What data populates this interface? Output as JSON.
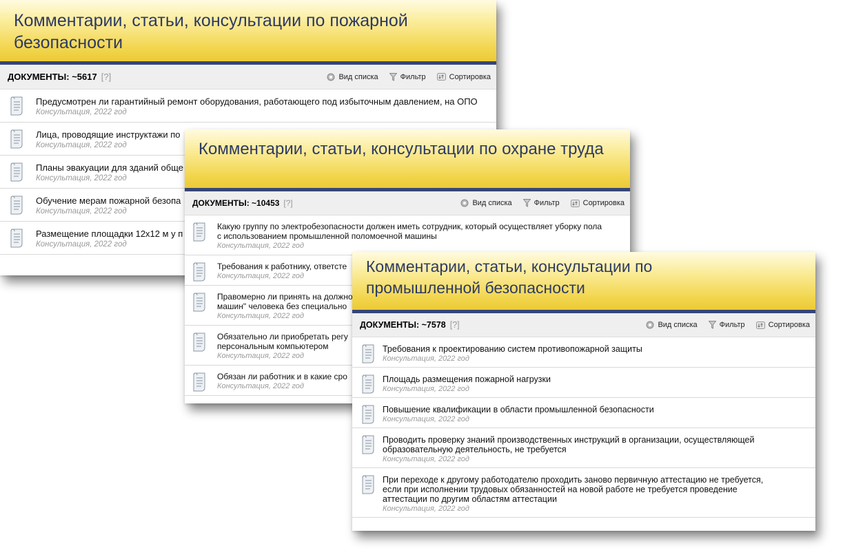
{
  "colors": {
    "header_gradient_top": "#fffbe0",
    "header_gradient_bottom": "#ecca38",
    "header_text": "#2e3a63",
    "header_rule": "#354677",
    "meta_text": "#9a9a9a"
  },
  "toolbar_labels": {
    "view": "Вид списка",
    "filter": "Фильтр",
    "sort": "Сортировка",
    "help": "[?]"
  },
  "panels": [
    {
      "title": "Комментарии, статьи, консультации по пожарной безопасности",
      "docs_label": "ДОКУМЕНТЫ: ~5617",
      "items": [
        {
          "title": "Предусмотрен ли гарантийный ремонт оборудования, работающего под избыточным давлением, на ОПО",
          "meta": "Консультация, 2022 год"
        },
        {
          "title": "Лица, проводящие инструктажи по",
          "meta": "Консультация, 2022 год"
        },
        {
          "title": "Планы эвакуации для зданий обще",
          "meta": "Консультация, 2022 год"
        },
        {
          "title": "Обучение мерам пожарной безопа",
          "meta": "Консультация, 2022 год"
        },
        {
          "title": "Размещение площадки 12х12 м у п",
          "meta": "Консультация, 2022 год"
        }
      ]
    },
    {
      "title": "Комментарии, статьи, консультации по охране труда",
      "docs_label": "ДОКУМЕНТЫ: ~10453",
      "items": [
        {
          "title": "Какую группу по электробезопасности должен иметь сотрудник, который осуществляет уборку пола с использованием промышленной поломоечной машины",
          "meta": "Консультация, 2022 год"
        },
        {
          "title": "Требования к работнику, ответсте",
          "meta": "Консультация, 2022 год"
        },
        {
          "title": "Правомерно ли принять на должно машин\" человека без специально",
          "meta": "Консультация, 2022 год"
        },
        {
          "title": "Обязательно ли приобретать регу персональным компьютером",
          "meta": "Консультация, 2022 год"
        },
        {
          "title": "Обязан ли работник и в какие сро",
          "meta": "Консультация, 2022 год"
        }
      ]
    },
    {
      "title": "Комментарии, статьи, консультации по промышленной безопасности",
      "docs_label": "ДОКУМЕНТЫ: ~7578",
      "items": [
        {
          "title": "Требования к проектированию систем противопожарной защиты",
          "meta": "Консультация, 2022 год"
        },
        {
          "title": "Площадь размещения пожарной нагрузки",
          "meta": "Консультация, 2022 год"
        },
        {
          "title": "Повышение квалификации в области промышленной безопасности",
          "meta": "Консультация, 2022 год"
        },
        {
          "title": "Проводить проверку знаний производственных инструкций в организации, осуществляющей образовательную деятельность, не требуется",
          "meta": "Консультация, 2022 год"
        },
        {
          "title": "При переходе к другому работодателю проходить заново первичную аттестацию не требуется, если при исполнении трудовых обязанностей на новой работе не требуется проведение аттестации по другим областям аттестации",
          "meta": "Консультация, 2022 год"
        }
      ]
    }
  ]
}
